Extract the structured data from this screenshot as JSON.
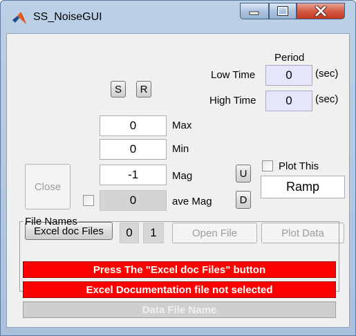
{
  "window": {
    "title": "SS_NoiseGUI",
    "icon": "matlab-logo-icon",
    "controls": [
      "minimize-icon",
      "maximize-icon",
      "close-icon"
    ]
  },
  "period": {
    "heading": "Period",
    "low_time_label": "Low Time",
    "low_time_value": "0",
    "high_time_label": "High Time",
    "high_time_value": "0",
    "unit": "(sec)"
  },
  "sr_buttons": {
    "s_label": "S",
    "r_label": "R"
  },
  "fields": {
    "max_value": "0",
    "max_label": "Max",
    "min_value": "0",
    "min_label": "Min",
    "mag_value": "-1",
    "mag_label": "Mag",
    "ave_mag_value": "0",
    "ave_mag_label": "ave Mag"
  },
  "ud_buttons": {
    "u_label": "U",
    "d_label": "D"
  },
  "plot": {
    "plot_this_label": "Plot This",
    "waveform_value": "Ramp"
  },
  "close_label": "Close",
  "file_row": {
    "excel_button_label": "Excel doc Files",
    "count_a": "0",
    "count_b": "1",
    "open_file_label": "Open File",
    "plot_data_label": "Plot Data"
  },
  "file_names": {
    "legend": "File Names",
    "line1": "Press The \"Excel doc Files\" button",
    "line2": "Excel Documentation file not selected",
    "line3": "Data File Name"
  },
  "colors": {
    "error_bar": "#ff0000",
    "edit_blue": "#e6e6fa",
    "disabled_field": "#d4d4d4"
  }
}
